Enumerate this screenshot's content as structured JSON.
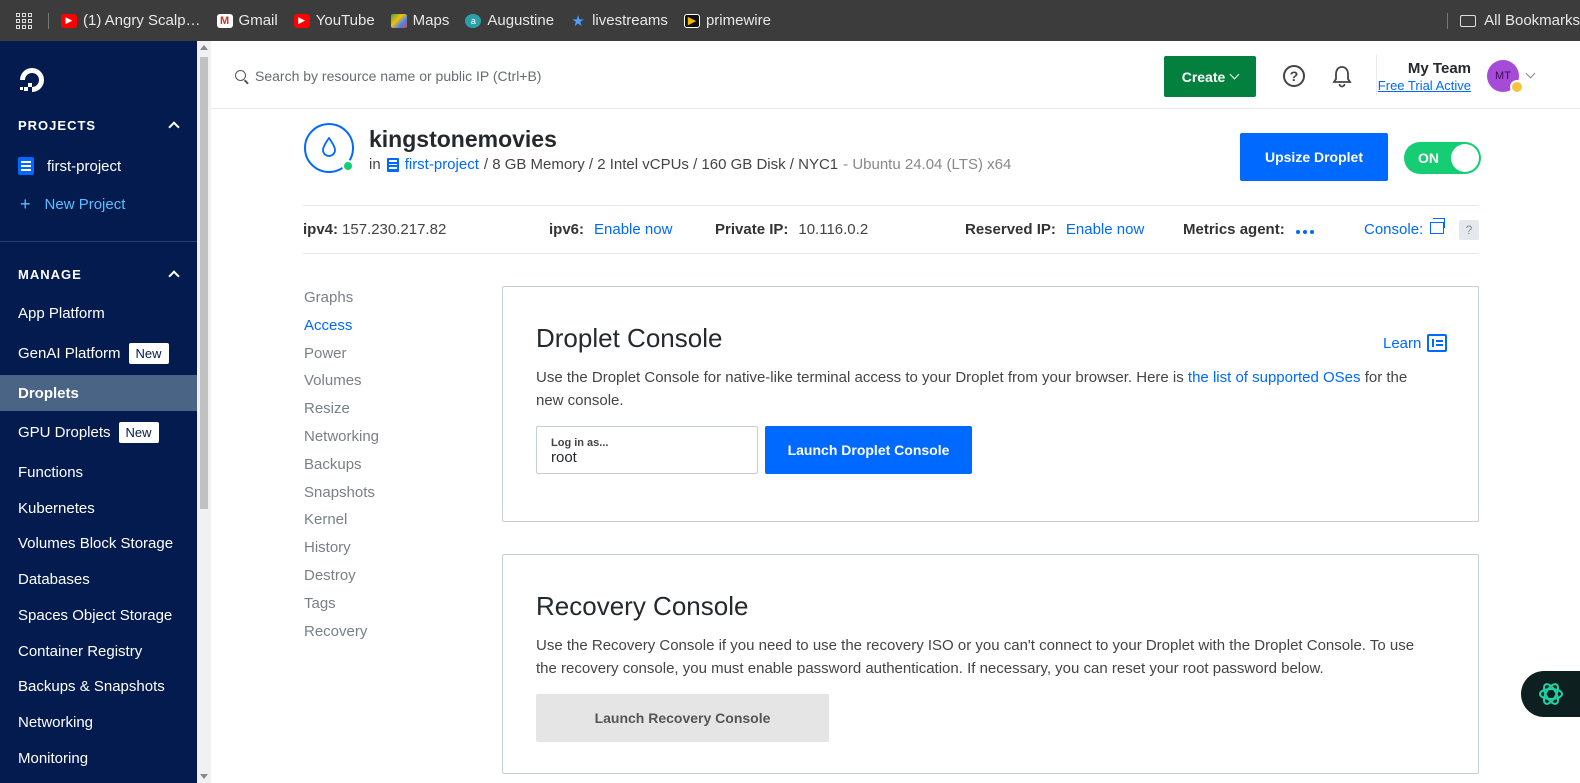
{
  "bookmarks": {
    "items": [
      {
        "label": "(1) Angry Scalp…",
        "icon": "youtube-icon"
      },
      {
        "label": "Gmail",
        "icon": "gmail-icon"
      },
      {
        "label": "YouTube",
        "icon": "youtube-icon"
      },
      {
        "label": "Maps",
        "icon": "maps-icon"
      },
      {
        "label": "Augustine",
        "icon": "augustine-icon"
      },
      {
        "label": "livestreams",
        "icon": "star-icon"
      },
      {
        "label": "primewire",
        "icon": "primewire-icon"
      }
    ],
    "all_bookmarks": "All Bookmarks"
  },
  "sidebar": {
    "projects_heading": "PROJECTS",
    "project": "first-project",
    "new_project": "New Project",
    "manage_heading": "MANAGE",
    "badge_new": "New",
    "items": [
      {
        "label": "App Platform"
      },
      {
        "label": "GenAI Platform",
        "badge": "New"
      },
      {
        "label": "Droplets",
        "active": true
      },
      {
        "label": "GPU Droplets",
        "badge": "New"
      },
      {
        "label": "Functions"
      },
      {
        "label": "Kubernetes"
      },
      {
        "label": "Volumes Block Storage"
      },
      {
        "label": "Databases"
      },
      {
        "label": "Spaces Object Storage"
      },
      {
        "label": "Container Registry"
      },
      {
        "label": "Backups & Snapshots"
      },
      {
        "label": "Networking"
      },
      {
        "label": "Monitoring"
      }
    ]
  },
  "header": {
    "search_placeholder": "Search by resource name or public IP (Ctrl+B)",
    "create_label": "Create",
    "team_name": "My Team",
    "trial_status": "Free Trial Active",
    "avatar_initials": "MT"
  },
  "droplet": {
    "name": "kingstonemovies",
    "in": "in",
    "project": "first-project",
    "specs": "/ 8 GB Memory / 2 Intel vCPUs / 160 GB Disk / NYC1",
    "os": "- Ubuntu 24.04 (LTS) x64",
    "upsize_label": "Upsize Droplet",
    "power_state": "ON"
  },
  "network": {
    "ipv4_label": "ipv4:",
    "ipv4_value": "157.230.217.82",
    "ipv6_label": "ipv6:",
    "ipv6_action": "Enable now",
    "private_label": "Private IP:",
    "private_value": "10.116.0.2",
    "reserved_label": "Reserved IP:",
    "reserved_action": "Enable now",
    "metrics_label": "Metrics agent:",
    "console_label": "Console:",
    "help": "?"
  },
  "tabs": [
    {
      "label": "Graphs"
    },
    {
      "label": "Access",
      "active": true
    },
    {
      "label": "Power"
    },
    {
      "label": "Volumes"
    },
    {
      "label": "Resize"
    },
    {
      "label": "Networking"
    },
    {
      "label": "Backups"
    },
    {
      "label": "Snapshots"
    },
    {
      "label": "Kernel"
    },
    {
      "label": "History"
    },
    {
      "label": "Destroy"
    },
    {
      "label": "Tags"
    },
    {
      "label": "Recovery"
    }
  ],
  "droplet_console": {
    "title": "Droplet Console",
    "learn": "Learn",
    "desc_before": "Use the Droplet Console for native-like terminal access to your Droplet from your browser. Here is ",
    "desc_link": "the list of supported OSes",
    "desc_after": " for the new console.",
    "login_label": "Log in as...",
    "login_value": "root",
    "launch_label": "Launch Droplet Console"
  },
  "recovery_console": {
    "title": "Recovery Console",
    "desc": "Use the Recovery Console if you need to use the recovery ISO or you can't connect to your Droplet with the Droplet Console. To use the recovery console, you must enable password authentication. If necessary, you can reset your root password below.",
    "launch_label": "Launch Recovery Console"
  },
  "colors": {
    "sidebar_bg": "#031b4e",
    "brand_blue": "#0069ff",
    "create_green": "#04803e",
    "status_green": "#15cd72"
  }
}
